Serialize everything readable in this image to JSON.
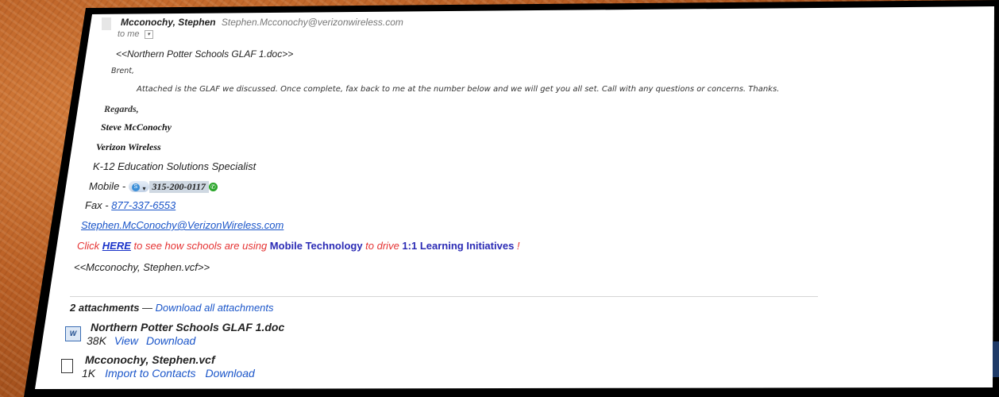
{
  "message": {
    "sender_name": "Mcconochy, Stephen",
    "sender_email": "Stephen.Mcconochy@verizonwireless.com",
    "to_line": "to me",
    "attachment_ref": "<<Northern Potter Schools GLAF 1.doc>>",
    "greeting": "Brent,",
    "body_text": "Attached is the GLAF we discussed.  Once complete, fax back to me at the number below and we will get you all set.  Call with any questions or concerns.  Thanks.",
    "regards": "Regards,",
    "signature": {
      "name": "Steve McConochy",
      "company": "Verizon Wireless",
      "title": "K-12 Education Solutions Specialist",
      "mobile_label": "Mobile - ",
      "mobile_number": "315-200-0117",
      "fax_label": "Fax - ",
      "fax_number": "877-337-6553",
      "email": "Stephen.McConochy@VerizonWireless.com"
    },
    "promo": {
      "part1": "Click ",
      "here": "HERE",
      "part2": " to see how schools are using ",
      "mobile_tech": "Mobile Technology",
      "part3": " to drive ",
      "initiatives": "1:1 Learning Initiatives",
      "end": " !"
    },
    "vcf_ref": "<<Mcconochy, Stephen.vcf>>"
  },
  "attachments": {
    "count_label": "2 attachments",
    "separator": " — ",
    "download_all": "Download all attachments",
    "items": [
      {
        "name": "Northern Potter Schools GLAF 1.doc",
        "size": "38K",
        "actions": [
          "View",
          "Download"
        ],
        "icon": "word-doc-icon"
      },
      {
        "name": "Mcconochy, Stephen.vcf",
        "size": "1K",
        "actions": [
          "Import to Contacts",
          "Download"
        ],
        "icon": "generic-file-icon"
      }
    ]
  }
}
